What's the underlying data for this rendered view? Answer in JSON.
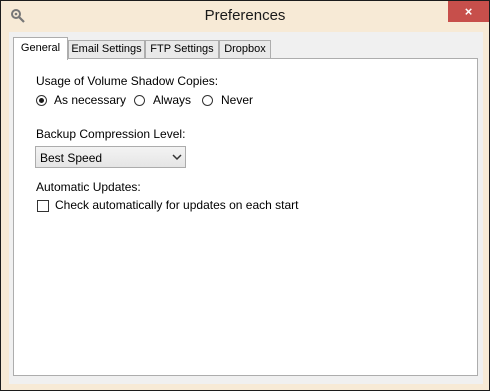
{
  "window": {
    "title": "Preferences",
    "close_glyph": "×",
    "app_icon": "gear-magnifier-icon"
  },
  "tabs": [
    {
      "label": "General",
      "active": true
    },
    {
      "label": "Email Settings",
      "active": false
    },
    {
      "label": "FTP Settings",
      "active": false
    },
    {
      "label": "Dropbox",
      "active": false
    }
  ],
  "general": {
    "vss_label": "Usage of Volume Shadow Copies:",
    "vss_options": [
      {
        "label": "As necessary",
        "checked": true
      },
      {
        "label": "Always",
        "checked": false
      },
      {
        "label": "Never",
        "checked": false
      }
    ],
    "compression_label": "Backup Compression Level:",
    "compression_value": "Best Speed",
    "updates_label": "Automatic Updates:",
    "updates_checkbox_label": "Check automatically for updates on each start",
    "updates_checked": false
  },
  "colors": {
    "titlebar": "#f7ead6",
    "close_button": "#c74f4b"
  }
}
